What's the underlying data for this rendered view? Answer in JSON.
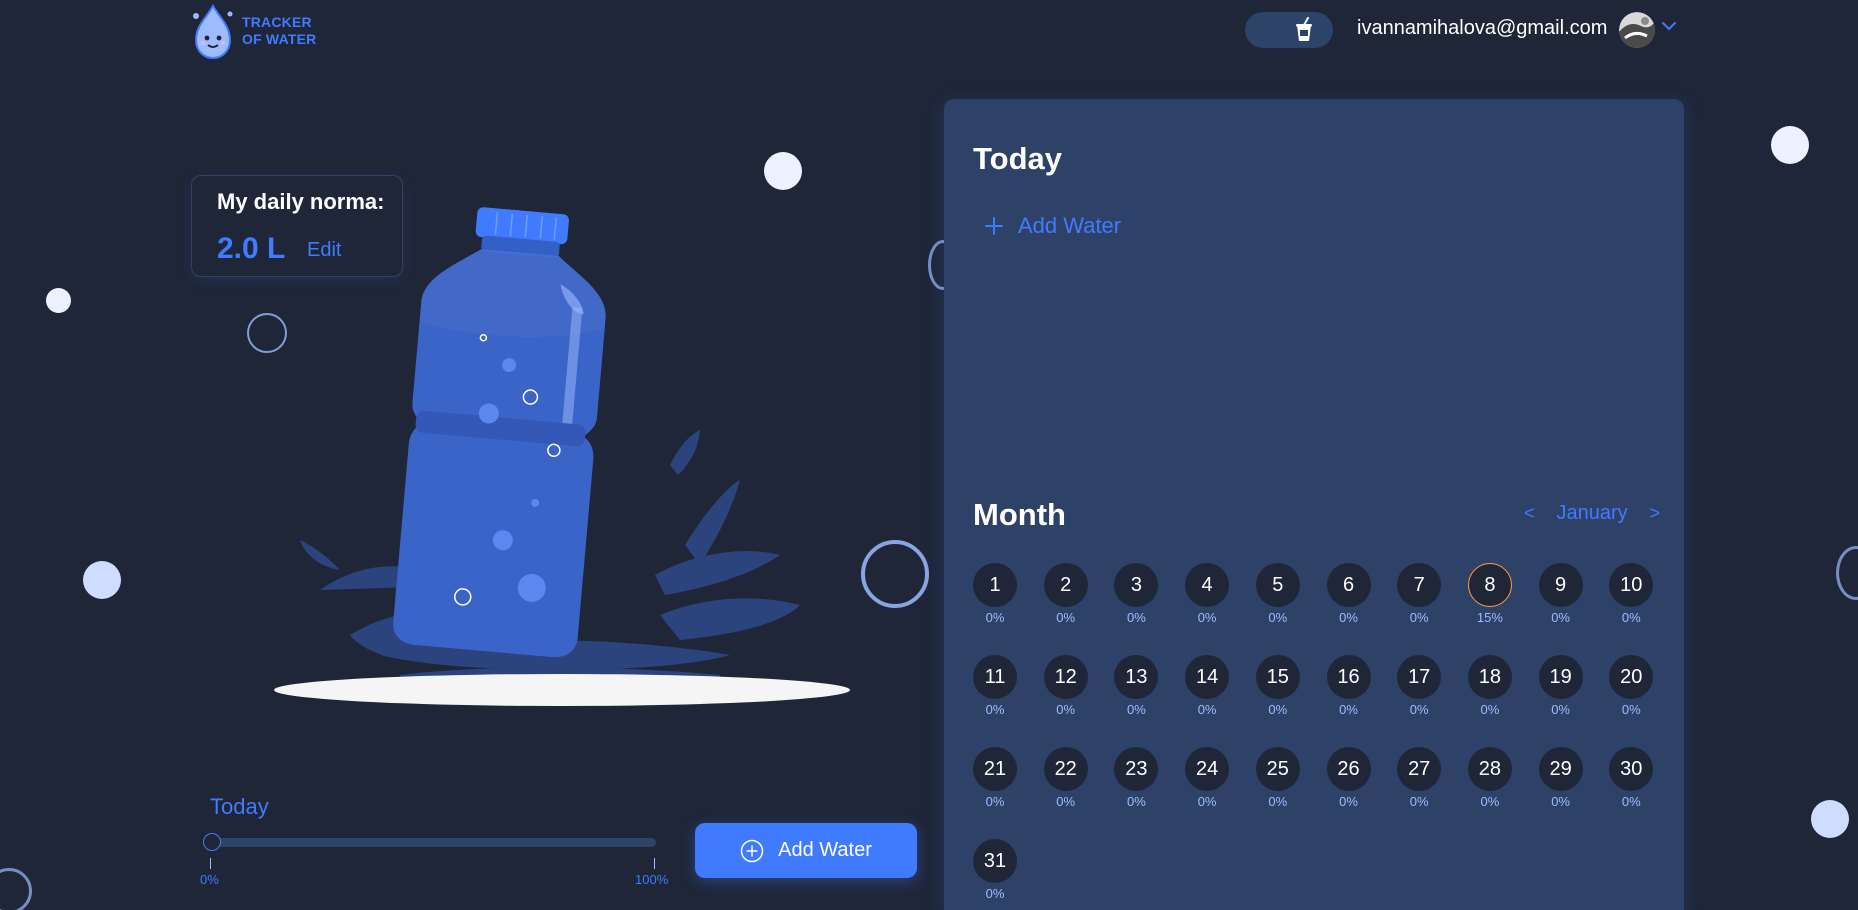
{
  "header": {
    "logo_line1": "TRACKER",
    "logo_line2": "OF WATER",
    "user_email": "ivannamihalova@gmail.com",
    "theme_icon": "cup-icon",
    "chevron_icon": "chevron-down-icon"
  },
  "norma": {
    "title": "My daily norma:",
    "value": "2.0 L",
    "edit_label": "Edit"
  },
  "progress": {
    "label": "Today",
    "value_percent": 0,
    "min_label": "0%",
    "max_label": "100%"
  },
  "add_water_button": {
    "label": "Add Water",
    "icon": "plus-circle-icon"
  },
  "panel": {
    "today_title": "Today",
    "add_water_label": "Add Water",
    "month_title": "Month",
    "month_name": "January",
    "prev_label": "<",
    "next_label": ">",
    "days": [
      {
        "day": "1",
        "pct": "0%"
      },
      {
        "day": "2",
        "pct": "0%"
      },
      {
        "day": "3",
        "pct": "0%"
      },
      {
        "day": "4",
        "pct": "0%"
      },
      {
        "day": "5",
        "pct": "0%"
      },
      {
        "day": "6",
        "pct": "0%"
      },
      {
        "day": "7",
        "pct": "0%"
      },
      {
        "day": "8",
        "pct": "15%",
        "active": true
      },
      {
        "day": "9",
        "pct": "0%"
      },
      {
        "day": "10",
        "pct": "0%"
      },
      {
        "day": "11",
        "pct": "0%"
      },
      {
        "day": "12",
        "pct": "0%"
      },
      {
        "day": "13",
        "pct": "0%"
      },
      {
        "day": "14",
        "pct": "0%"
      },
      {
        "day": "15",
        "pct": "0%"
      },
      {
        "day": "16",
        "pct": "0%"
      },
      {
        "day": "17",
        "pct": "0%"
      },
      {
        "day": "18",
        "pct": "0%"
      },
      {
        "day": "19",
        "pct": "0%"
      },
      {
        "day": "20",
        "pct": "0%"
      },
      {
        "day": "21",
        "pct": "0%"
      },
      {
        "day": "22",
        "pct": "0%"
      },
      {
        "day": "23",
        "pct": "0%"
      },
      {
        "day": "24",
        "pct": "0%"
      },
      {
        "day": "25",
        "pct": "0%"
      },
      {
        "day": "26",
        "pct": "0%"
      },
      {
        "day": "27",
        "pct": "0%"
      },
      {
        "day": "28",
        "pct": "0%"
      },
      {
        "day": "29",
        "pct": "0%"
      },
      {
        "day": "30",
        "pct": "0%"
      },
      {
        "day": "31",
        "pct": "0%"
      }
    ]
  },
  "colors": {
    "background": "#1f2638",
    "panel": "#2e4268",
    "accent": "#407bff",
    "light_accent": "#9ebbff",
    "active_day_border": "#ff9d43"
  }
}
